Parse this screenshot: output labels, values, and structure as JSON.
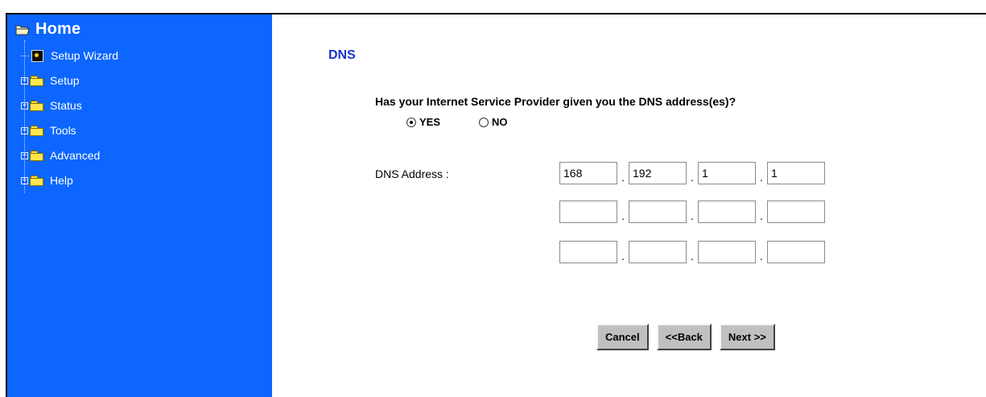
{
  "sidebar": {
    "home_label": "Home",
    "items": [
      {
        "label": "Setup Wizard",
        "icon": "wizard-icon",
        "expandable": false
      },
      {
        "label": "Setup",
        "icon": "folder-icon",
        "expandable": true
      },
      {
        "label": "Status",
        "icon": "folder-icon",
        "expandable": true
      },
      {
        "label": "Tools",
        "icon": "folder-icon",
        "expandable": true
      },
      {
        "label": "Advanced",
        "icon": "folder-icon",
        "expandable": true
      },
      {
        "label": "Help",
        "icon": "folder-icon",
        "expandable": true
      }
    ],
    "expander_glyph": "+",
    "background_color": "#0c66ff"
  },
  "content": {
    "title": "DNS",
    "title_color": "#1a33cc",
    "question": "Has your Internet Service Provider given you the DNS address(es)?",
    "radio": {
      "options": [
        {
          "label": "YES",
          "checked": true
        },
        {
          "label": "NO",
          "checked": false
        }
      ]
    },
    "dns_label": "DNS Address :",
    "dns_rows": [
      [
        "168",
        "192",
        "1",
        "1"
      ],
      [
        "",
        "",
        "",
        ""
      ],
      [
        "",
        "",
        "",
        ""
      ]
    ],
    "separator": ".",
    "buttons": {
      "cancel": "Cancel",
      "back": "<<Back",
      "next": "Next >>"
    }
  }
}
